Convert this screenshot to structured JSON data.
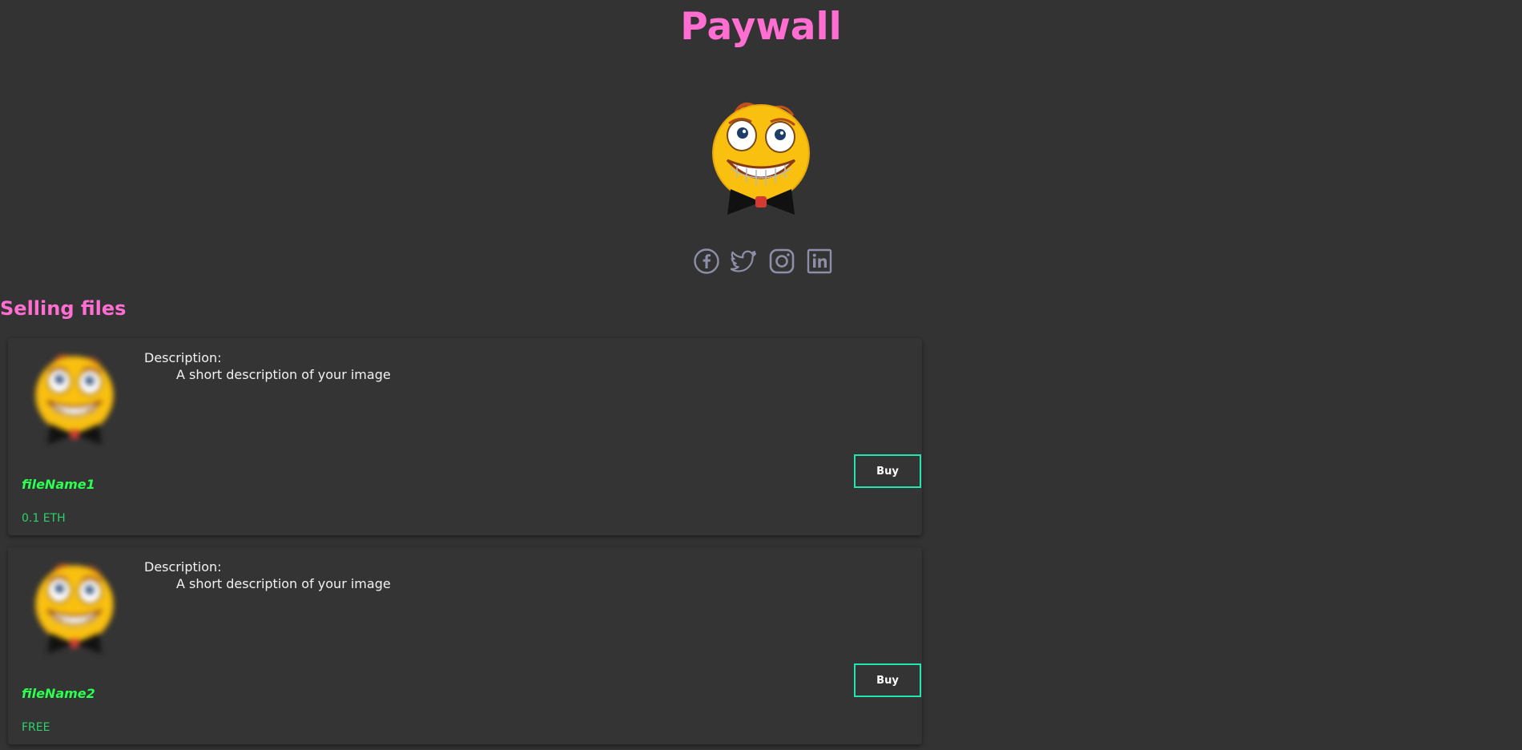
{
  "header": {
    "title": "Paywall"
  },
  "avatar": {
    "icon": "grinning-bowtie-face-icon"
  },
  "socials": [
    {
      "name": "facebook-icon"
    },
    {
      "name": "twitter-icon"
    },
    {
      "name": "instagram-icon"
    },
    {
      "name": "linkedin-icon"
    }
  ],
  "section": {
    "title": "Selling files"
  },
  "files": [
    {
      "description_label": "Description:",
      "description": "A short description of your image",
      "name": "fileName1",
      "price": "0.1 ETH",
      "buy_label": "Buy"
    },
    {
      "description_label": "Description:",
      "description": "A short description of your image",
      "name": "fileName2",
      "price": "FREE",
      "buy_label": "Buy"
    }
  ],
  "colors": {
    "background": "#333333",
    "title": "#ff6ed0",
    "file_name": "#2bff4f",
    "price": "#2bd36a",
    "button_border": "#21e6b0",
    "social_icon": "#8d8ea8"
  }
}
